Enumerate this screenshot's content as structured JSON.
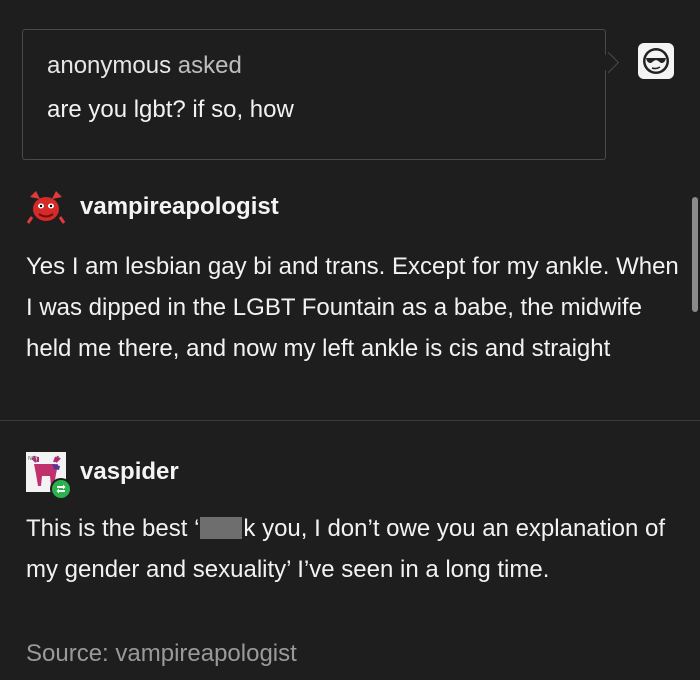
{
  "ask": {
    "asker": "anonymous",
    "asked_label": "asked",
    "question": "are you lgbt? if so, how",
    "avatar_icon": "sunglasses-icon"
  },
  "post1": {
    "username": "vampireapologist",
    "avatar_icon": "red-creature-avatar-icon",
    "body": "Yes I am lesbian gay bi and trans. Except for my ankle. When I was dipped in the LGBT Fountain as a babe, the midwife held me there, and now my left ankle is cis and straight"
  },
  "post2": {
    "username": "vaspider",
    "avatar_icon": "moose-avatar-icon",
    "reblog_icon": "reblog-icon",
    "body_before": "This is the best ‘",
    "body_after": "k you, I don’t owe you an explanation of my gender and sexuality’ I’ve seen in a long time."
  },
  "source": {
    "text": "Source: vampireapologist"
  },
  "colors": {
    "background": "#1e1e1e",
    "text": "#f2f2f2",
    "muted": "#9a9a9a",
    "border": "#4a4a4a",
    "reblog_green": "#2bb24c"
  }
}
